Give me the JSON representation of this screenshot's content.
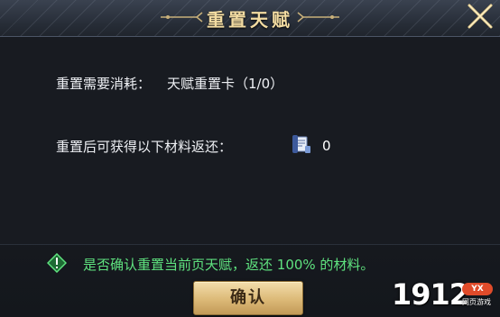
{
  "dialog": {
    "title": "重置天赋",
    "close_icon": "close-x-icon"
  },
  "cost": {
    "label": "重置需要消耗：",
    "item": "天赋重置卡（1/0）"
  },
  "refund": {
    "label": "重置后可获得以下材料返还：",
    "icon": "scroll-icon",
    "count": "0"
  },
  "confirm": {
    "icon": "warning-diamond-icon",
    "message": "是否确认重置当前页天赋，返还 100% 的材料。"
  },
  "button": {
    "label": "确认"
  },
  "watermark": {
    "number": "1912",
    "badge": "YX",
    "subtitle": "网页游戏"
  },
  "colors": {
    "title": "#f3dca2",
    "confirm_text": "#5fe27f",
    "button": "#dcb977"
  }
}
